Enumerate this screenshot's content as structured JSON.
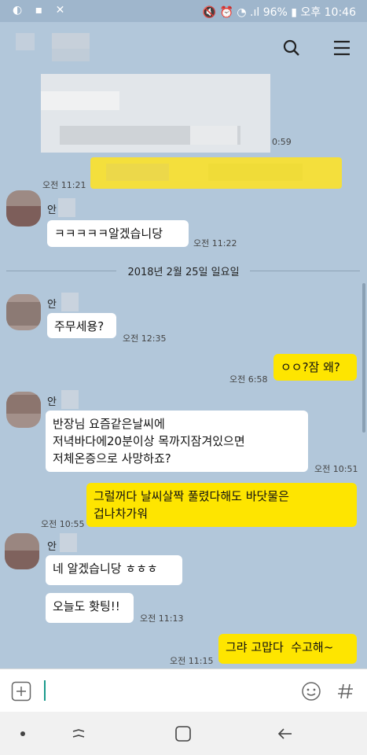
{
  "status": {
    "battery": "96%",
    "time": "오후 10:46"
  },
  "chat": {
    "date_separator": "2018년 2월 25일 일요일",
    "top_time": "0:59",
    "messages": [
      {
        "text": "",
        "time": "오전 11:21"
      },
      {
        "text": "ㅋㅋㅋㅋㅋ알겠습니당",
        "time": "오전 11:22"
      },
      {
        "text": "주무세용?",
        "time": "오전 12:35"
      },
      {
        "text": "ㅇㅇ?잠 왜?",
        "time": "오전 6:58"
      },
      {
        "text": "반장님 요즘같은날씨에\n저녁바다에20분이상 목까지잠겨있으면\n저체온증으로 사망하죠?",
        "time": "오전 10:51"
      },
      {
        "text": "그럴꺼다 날씨살짝 풀렸다해도 바닷물은\n겁나차가워",
        "time": "오전 10:55"
      },
      {
        "text": "네 알겠습니당 ㅎㅎㅎ",
        "time": ""
      },
      {
        "text": "오늘도 홧팅!!",
        "time": "오전 11:13"
      },
      {
        "text": "그랴 고맙다  수고해~",
        "time": "오전 11:15"
      }
    ],
    "sender_name_prefix": "안"
  },
  "icons": {
    "search": "search-icon",
    "menu": "menu-icon",
    "add": "plus-icon",
    "emoji": "emoji-icon",
    "hashtag": "hashtag-icon"
  },
  "colors": {
    "chat_bg": "#b2c7da",
    "my_bubble": "#fee500",
    "their_bubble": "#ffffff"
  }
}
